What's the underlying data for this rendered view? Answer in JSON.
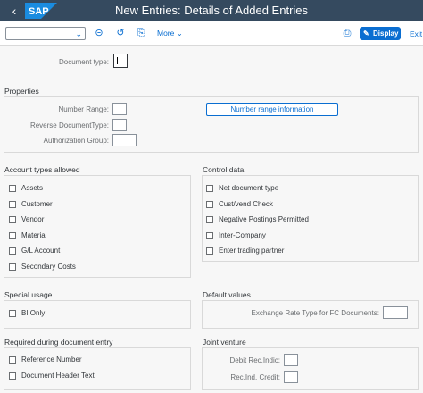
{
  "header": {
    "title": "New Entries: Details of Added Entries",
    "back_icon": "back-icon",
    "logo": "SAP"
  },
  "toolbar": {
    "select_value": "",
    "more_label": "More",
    "display_label": "Display",
    "exit_label": "Exit"
  },
  "document_type": {
    "label": "Document type:",
    "value": ""
  },
  "properties": {
    "title": "Properties",
    "number_range_label": "Number Range:",
    "reverse_doc_label": "Reverse DocumentType:",
    "auth_group_label": "Authorization Group:",
    "number_range_info_label": "Number range information"
  },
  "account_types": {
    "title": "Account types allowed",
    "items": [
      "Assets",
      "Customer",
      "Vendor",
      "Material",
      "G/L Account",
      "Secondary Costs"
    ]
  },
  "control_data": {
    "title": "Control data",
    "items": [
      "Net document type",
      "Cust/vend Check",
      "Negative Postings Permitted",
      "Inter-Company",
      "Enter trading partner"
    ]
  },
  "special_usage": {
    "title": "Special usage",
    "items": [
      "BI Only"
    ]
  },
  "default_values": {
    "title": "Default values",
    "exchange_rate_label": "Exchange Rate Type for FC Documents:"
  },
  "required_entry": {
    "title": "Required during document entry",
    "items": [
      "Reference Number",
      "Document Header Text"
    ]
  },
  "joint_venture": {
    "title": "Joint venture",
    "debit_label": "Debit Rec.Indic:",
    "credit_label": "Rec.Ind. Credit:"
  },
  "colors": {
    "shell": "#354a5f",
    "accent": "#0a6ed1"
  }
}
